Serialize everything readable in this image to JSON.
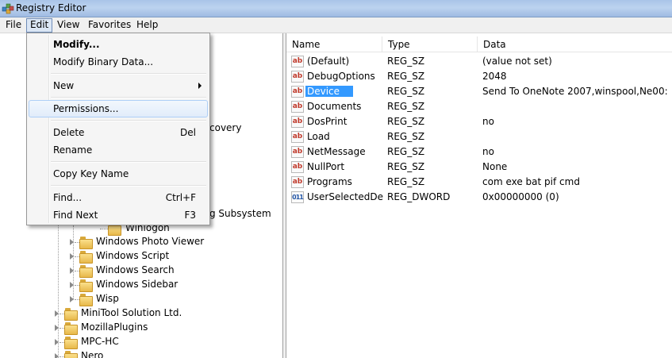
{
  "window": {
    "title": "Registry Editor"
  },
  "menubar": {
    "items": [
      "File",
      "Edit",
      "View",
      "Favorites",
      "Help"
    ]
  },
  "edit_menu": {
    "modify": "Modify...",
    "modify_binary": "Modify Binary Data...",
    "new": "New",
    "permissions": "Permissions...",
    "delete": "Delete",
    "delete_shortcut": "Del",
    "rename": "Rename",
    "copy_key_name": "Copy Key Name",
    "find": "Find...",
    "find_shortcut": "Ctrl+F",
    "find_next": "Find Next",
    "find_next_shortcut": "F3"
  },
  "tree": {
    "partial_recovery": "covery",
    "partial_subsystem": "g Subsystem",
    "partial_winlogon": "Winlogon",
    "items": [
      "Windows Photo Viewer",
      "Windows Script",
      "Windows Search",
      "Windows Sidebar",
      "Wisp",
      "MiniTool Solution Ltd.",
      "MozillaPlugins",
      "MPC-HC",
      "Nero"
    ]
  },
  "values": {
    "columns": {
      "name": "Name",
      "type": "Type",
      "data": "Data"
    },
    "rows": [
      {
        "name": "(Default)",
        "type": "REG_SZ",
        "data": "(value not set)"
      },
      {
        "name": "DebugOptions",
        "type": "REG_SZ",
        "data": "2048"
      },
      {
        "name": "Device",
        "type": "REG_SZ",
        "data": "Send To OneNote 2007,winspool,Ne00:"
      },
      {
        "name": "Documents",
        "type": "REG_SZ",
        "data": ""
      },
      {
        "name": "DosPrint",
        "type": "REG_SZ",
        "data": "no"
      },
      {
        "name": "Load",
        "type": "REG_SZ",
        "data": ""
      },
      {
        "name": "NetMessage",
        "type": "REG_SZ",
        "data": "no"
      },
      {
        "name": "NullPort",
        "type": "REG_SZ",
        "data": "None"
      },
      {
        "name": "Programs",
        "type": "REG_SZ",
        "data": "com exe bat pif cmd"
      },
      {
        "name": "UserSelectedDef...",
        "type": "REG_DWORD",
        "data": "0x00000000 (0)"
      }
    ],
    "icon_sz": "ab",
    "icon_dword": "011"
  }
}
